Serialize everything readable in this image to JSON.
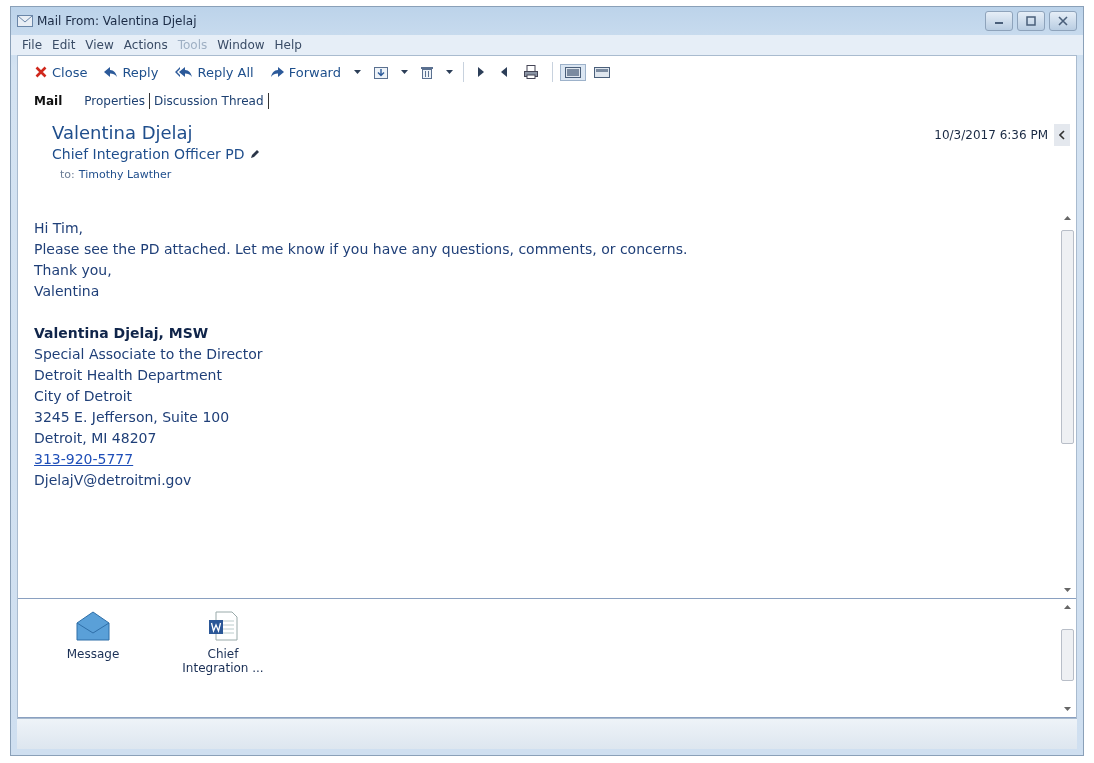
{
  "window": {
    "title": "Mail From: Valentina Djelaj"
  },
  "menu": [
    {
      "label": "File",
      "disabled": false
    },
    {
      "label": "Edit",
      "disabled": false
    },
    {
      "label": "View",
      "disabled": false
    },
    {
      "label": "Actions",
      "disabled": false
    },
    {
      "label": "Tools",
      "disabled": true
    },
    {
      "label": "Window",
      "disabled": false
    },
    {
      "label": "Help",
      "disabled": false
    }
  ],
  "toolbar": [
    {
      "label": "Close",
      "has_menu": false
    },
    {
      "label": "Reply",
      "has_menu": false
    },
    {
      "label": "Reply All",
      "has_menu": false
    },
    {
      "label": "Forward",
      "has_menu": true
    },
    {
      "has_menu": true
    },
    {
      "has_menu": true
    }
  ],
  "view_buttons": [
    {
      "selected": true
    },
    {
      "selected": false
    }
  ],
  "tabs": [
    {
      "label": "Mail",
      "selected": true
    },
    {
      "label": "Properties",
      "selected": false
    },
    {
      "label": "Discussion Thread",
      "selected": false
    }
  ],
  "header": {
    "sender": "Valentina Djelaj",
    "subject": "Chief Integration Officer PD",
    "to_label": "to:",
    "to": "Timothy Lawther",
    "date": "10/3/2017 6:36 PM"
  },
  "body": {
    "lines": [
      "Hi Tim,",
      "Please see the PD attached. Let me know if you have any questions, comments, or concerns.",
      "Thank you,",
      "Valentina"
    ],
    "signature": [
      {
        "text": "Valentina Djelaj, MSW",
        "kind": "bold"
      },
      {
        "text": "Special Associate to the Director",
        "kind": "plain"
      },
      {
        "text": "Detroit Health Department",
        "kind": "plain"
      },
      {
        "text": "City of Detroit",
        "kind": "plain"
      },
      {
        "text": "3245 E. Jefferson, Suite 100",
        "kind": "plain"
      },
      {
        "text": "Detroit, MI  48207",
        "kind": "plain"
      },
      {
        "text": "313-920-5777",
        "kind": "link"
      },
      {
        "text": "DjelajV@detroitmi.gov",
        "kind": "plain"
      }
    ]
  },
  "attachments": [
    {
      "label": "Message",
      "kind": "message"
    },
    {
      "label": "Chief Integration ...",
      "kind": "word"
    }
  ]
}
